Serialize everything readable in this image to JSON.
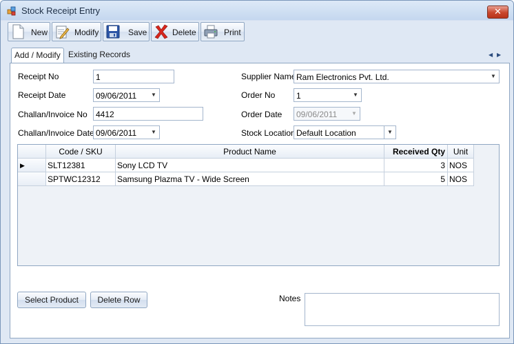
{
  "window": {
    "title": "Stock Receipt Entry",
    "close_label": "✕"
  },
  "toolbar": {
    "new_label": "New",
    "modify_label": "Modify",
    "save_label": "Save",
    "delete_label": "Delete",
    "print_label": "Print"
  },
  "tabs": [
    {
      "label": "Add / Modify",
      "active": true
    },
    {
      "label": "Existing Records",
      "active": false
    }
  ],
  "tab_nav": {
    "prev": "◀",
    "next": "▶"
  },
  "form": {
    "receipt_no": {
      "label": "Receipt No",
      "value": "1"
    },
    "receipt_date": {
      "label": "Receipt Date",
      "value": "09/06/2011"
    },
    "challan_no": {
      "label": "Challan/Invoice No",
      "value": "4412"
    },
    "challan_date": {
      "label": "Challan/Invoice Date",
      "value": "09/06/2011"
    },
    "supplier_name": {
      "label": "Supplier Name",
      "value": "Ram Electronics Pvt. Ltd."
    },
    "order_no": {
      "label": "Order No",
      "value": "1"
    },
    "order_date": {
      "label": "Order Date",
      "value": "09/06/2011"
    },
    "stock_location": {
      "label": "Stock Location",
      "value": "Default Location"
    }
  },
  "grid": {
    "columns": [
      "Code / SKU",
      "Product Name",
      "Received Qty",
      "Unit"
    ],
    "rows": [
      {
        "code": "SLT12381",
        "product": "Sony LCD TV",
        "qty": "3",
        "unit": "NOS"
      },
      {
        "code": "SPTWC12312",
        "product": "Samsung Plazma TV - Wide Screen",
        "qty": "5",
        "unit": "NOS"
      }
    ],
    "current_row_marker": "▶"
  },
  "buttons": {
    "select_product": "Select Product",
    "delete_row": "Delete Row"
  },
  "notes": {
    "label": "Notes",
    "value": ""
  },
  "dropdown_arrow": "▼",
  "colors": {
    "title_text": "#1e2f46",
    "border": "#8fa6c2",
    "close": "#c9462c"
  }
}
